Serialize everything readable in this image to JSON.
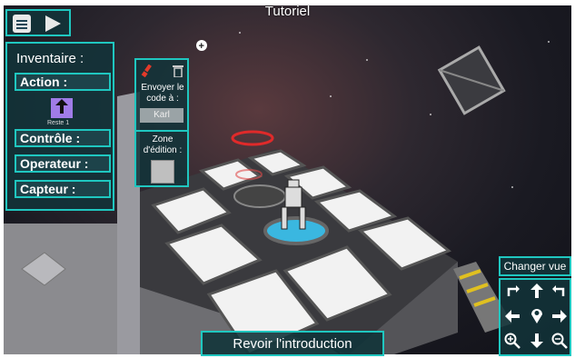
{
  "header": {
    "title": "Tutoriel",
    "menu_icon": "menu-icon",
    "play_icon": "play-icon"
  },
  "inventory": {
    "title": "Inventaire :",
    "slots": [
      "Action :",
      "Contrôle :",
      "Operateur :",
      "Capteur :"
    ],
    "action_block": {
      "icon": "arrow-up-icon",
      "label": "Reste 1"
    }
  },
  "editor": {
    "send_label": "Envoyer le code à :",
    "recipient": "Karl",
    "zone_label": "Zone d'édition :",
    "brush_icon": "brush-icon",
    "trash_icon": "trash-icon"
  },
  "camera": {
    "change_view_label": "Changer vue",
    "controls": [
      "rotate-left-icon",
      "arrow-up-icon",
      "rotate-right-icon",
      "arrow-left-icon",
      "location-pin-icon",
      "arrow-right-icon",
      "zoom-in-icon",
      "arrow-down-icon",
      "zoom-out-icon"
    ]
  },
  "footer": {
    "intro_button": "Revoir l'introduction"
  },
  "colors": {
    "accent": "#1fc7c0",
    "panel_bg": "#12343a",
    "action_block": "#a07ce8"
  }
}
